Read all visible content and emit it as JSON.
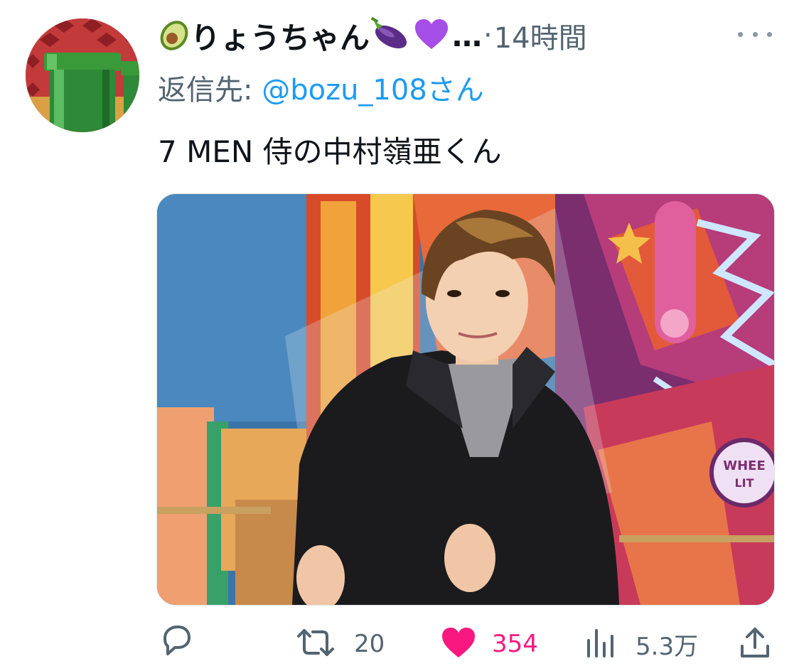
{
  "user": {
    "display_name": "りょうちゃん",
    "ellipsis": "…",
    "separator": "·",
    "emojis": [
      "avocado-emoji",
      "eggplant-emoji",
      "purple-heart-emoji"
    ]
  },
  "tweet": {
    "timestamp": "14時間",
    "reply_prefix": "返信先: ",
    "reply_to": "@bozu_108さん",
    "text": "7 MEN 侍の中村嶺亜くん"
  },
  "image_text": {
    "sign_line1": "WHEE",
    "sign_line2": "LIT"
  },
  "actions": {
    "reply": {
      "icon": "reply-bubble-icon",
      "count": ""
    },
    "retweet": {
      "icon": "retweet-icon",
      "count": "20"
    },
    "like": {
      "icon": "heart-icon",
      "count": "354",
      "color": "#f91880"
    },
    "views": {
      "icon": "views-bar-chart-icon",
      "count": "5.3万"
    },
    "share": {
      "icon": "share-upload-icon",
      "count": ""
    }
  },
  "colors": {
    "text_primary": "#0f1419",
    "text_secondary": "#536471",
    "link": "#1d9bf0",
    "like": "#f91880"
  }
}
